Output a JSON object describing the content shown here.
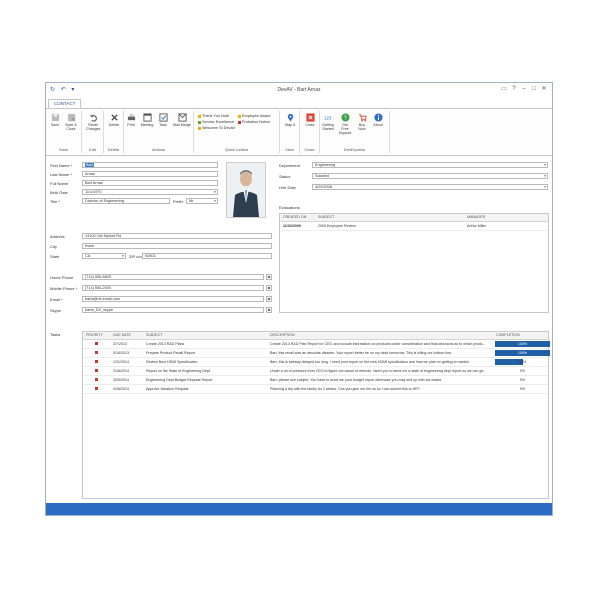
{
  "window": {
    "title": "DevAV - Bart Arnaz"
  },
  "tabs": [
    "CONTACT"
  ],
  "ribbon": {
    "groups": [
      {
        "label": "Save",
        "buttons": [
          "Save",
          "Save & Close"
        ]
      },
      {
        "label": "Edit",
        "buttons": [
          "Reset Changes"
        ]
      },
      {
        "label": "Delete",
        "buttons": [
          "Delete"
        ]
      },
      {
        "label": "Actions",
        "buttons": [
          "Print",
          "Meeting",
          "Task",
          "Mail Merge"
        ]
      },
      {
        "label": "Quick Letters",
        "letters": [
          "Thank You Note",
          "Employee Award",
          "Service Excellence",
          "Probation Notice",
          "Welcome To DevAV"
        ]
      },
      {
        "label": "View",
        "buttons": [
          "Map It"
        ]
      },
      {
        "label": "Close",
        "buttons": [
          "Close"
        ]
      },
      {
        "label": "DevExpress",
        "buttons": [
          "Getting Started",
          "Get Free Support",
          "Buy Now",
          "About"
        ]
      }
    ]
  },
  "form": {
    "first_name_label": "First Name *",
    "first_name": "Bart",
    "last_name_label": "Last Name *",
    "last_name": "Arnaz",
    "full_name_label": "Full Name",
    "full_name": "Bart Arnaz",
    "birth_date_label": "Birth Date",
    "birth_date": "11/1/1970",
    "title_label": "Title *",
    "title": "Director of Engineering",
    "prefix_label": "Prefix",
    "prefix": "Mr",
    "address_label": "Address",
    "address": "13109 Old Myford Rd",
    "city_label": "City",
    "city": "Irvine",
    "state_label": "State",
    "state": "CA",
    "zip_label": "ZIP code",
    "zip": "92602",
    "home_phone_label": "Home Phone",
    "home_phone": "(714) 555-8829",
    "mobile_phone_label": "Mobile Phone *",
    "mobile_phone": "(714) 555-2000",
    "email_label": "Email *",
    "email": "barta@dx-email.com",
    "skype_label": "Skype",
    "skype": "barta_DX_skype",
    "department_label": "Department",
    "department": "Engineering",
    "status_label": "Status",
    "status": "Salaried",
    "hire_date_label": "Hire Date",
    "hire_date": "4/29/2008"
  },
  "evaluations": {
    "label": "Evaluations",
    "columns": [
      "CREATED ON",
      "SUBJECT",
      "MANAGER"
    ],
    "rows": [
      {
        "created": "11/30/2009",
        "subject": "2009 Employee Review",
        "manager": "Arthur Miller"
      }
    ]
  },
  "tasks": {
    "label": "Tasks",
    "columns": [
      "PRIORITY",
      "DUE DATE",
      "SUBJECT",
      "DESCRIPTION",
      "COMPLETION"
    ],
    "rows": [
      {
        "due": "2/7/2013",
        "subject": "Create 2013 R&D Plans",
        "description": "Create 2013 R&D Plan Report for CEO and include information on products under consideration and final decisions as to which produ...",
        "completion": "100%",
        "fill": 1.0
      },
      {
        "due": "5/16/2013",
        "subject": "Prepare Product Recall Report",
        "description": "Bart, this recall was an absolute disaster. Your report better be on my desk tomorrow. This is killing our bottom line.",
        "completion": "100%",
        "fill": 1.0
      },
      {
        "due": "1/31/2014",
        "subject": "Review New HDMI Specification",
        "description": "Bart, this is already delayed too long. I need your report on the new HDMI specification and how we plan on getting to market.",
        "completion": "50%",
        "fill": 0.5
      },
      {
        "due": "2/16/2014",
        "subject": "Report on the State of Engineering Dept",
        "description": "Under a lot of pressure from CEO to figure out cause of refunds. Need you to send me a state of engineering dept report so we can ge...",
        "completion": "0%",
        "fill": 0
      },
      {
        "due": "3/25/2014",
        "subject": "Engineering Dept Budget Request Report",
        "description": "Bart, please see subject. You have to send me your budget report otherwise you may end up with cut-backs.",
        "completion": "0%",
        "fill": 0
      },
      {
        "due": "4/26/2014",
        "subject": "Approve Vacation Request",
        "description": "Planning a trip with the family for 2 weeks. Can you give me the ok so I can submit this to HR?",
        "completion": "0%",
        "fill": 0
      }
    ]
  },
  "colors": {
    "accent": "#2b6cc4",
    "bar": "#1f5fa5"
  }
}
